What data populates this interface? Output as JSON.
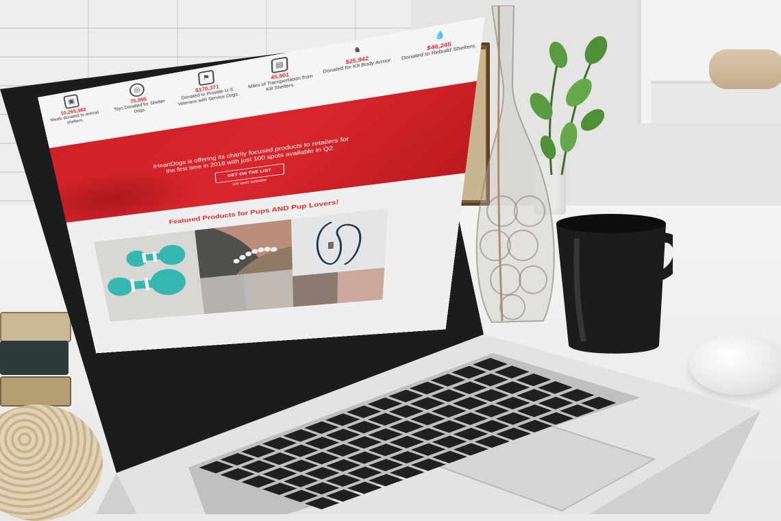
{
  "site": {
    "stats": [
      {
        "icon": "food-bag-icon",
        "value": "10,265,982",
        "label": "Meals donated to animal shelters."
      },
      {
        "icon": "ball-icon",
        "value": "75,995",
        "label": "Toys Donated for Shelter Dogs."
      },
      {
        "icon": "flag-icon",
        "value": "$170,371",
        "label": "Donated to Provide U.S. Veterans with Service Dogs."
      },
      {
        "icon": "carrier-icon",
        "value": "45,901",
        "label": "Miles of Transportation from Kill Shelters."
      },
      {
        "icon": "k9-dog-icon",
        "value": "$25,942",
        "label": "Donated for K9 Body Armor."
      },
      {
        "icon": "water-drop-icon",
        "value": "$46,245",
        "label": "Donated to Rebuild Shelters."
      }
    ],
    "hero": {
      "text": "iHeartDogs is offering its charity focused products to retailers for the first time in 2018 with just 100 spots available in Q2.",
      "button_label": "GET ON THE LIST",
      "note": "100 spots available"
    },
    "featured": {
      "title": "Featured Products for Pups AND Pup Lovers!"
    }
  },
  "colors": {
    "brand_red": "#d92b2f",
    "hero_red": "#cf2127",
    "toy_teal": "#35b8b0"
  }
}
